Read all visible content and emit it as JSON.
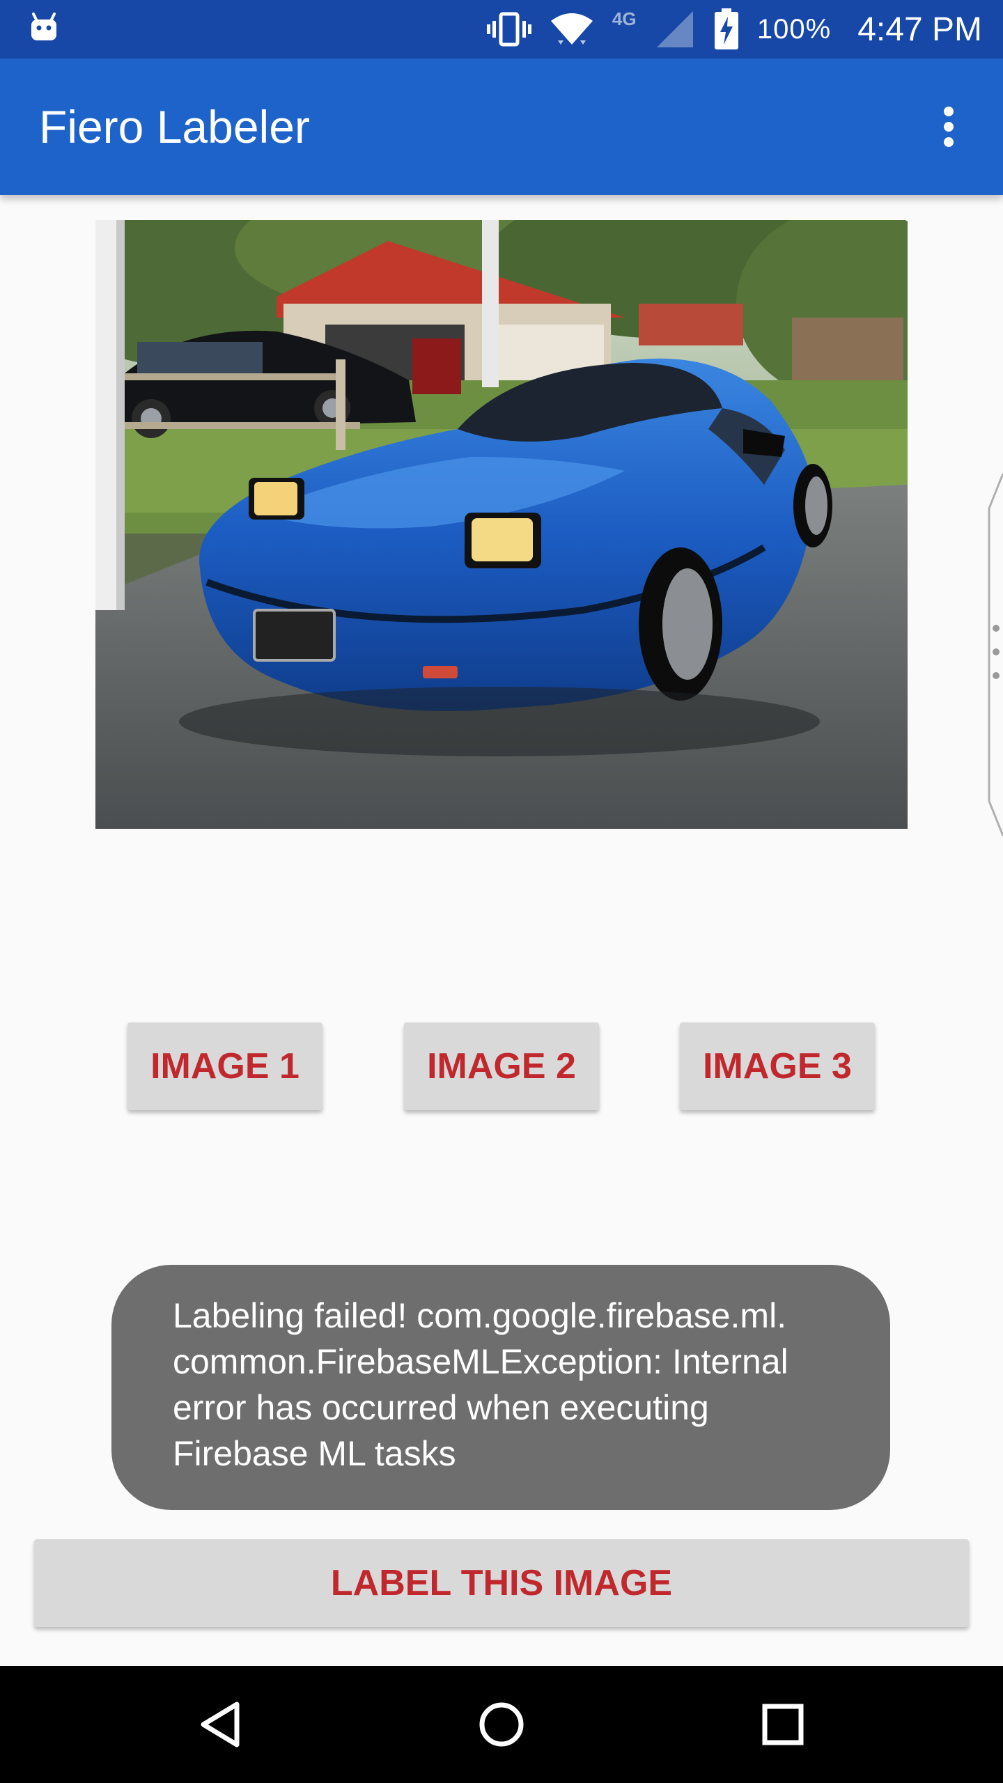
{
  "status_bar": {
    "battery_percent": "100%",
    "time": "4:47 PM",
    "network": "4G",
    "icons": [
      "android-icon",
      "vibrate-icon",
      "wifi-icon",
      "cell-signal-icon",
      "battery-charging-icon"
    ]
  },
  "app_bar": {
    "title": "Fiero Labeler",
    "menu_icon": "more-vert-icon"
  },
  "photo": {
    "subject": "blue-sports-car-photo"
  },
  "buttons": {
    "image1": "IMAGE 1",
    "image2": "IMAGE 2",
    "image3": "IMAGE 3",
    "label": "LABEL THIS IMAGE"
  },
  "toast": {
    "message": "Labeling failed! com.google.firebase.ml.\ncommon.FirebaseMLException: Internal\nerror has occurred when executing\nFirebase ML tasks"
  },
  "nav_bar": {
    "icons": [
      "back-icon",
      "home-icon",
      "recents-icon"
    ]
  },
  "colors": {
    "status_bar": "#1748a8",
    "app_bar": "#1e63c9",
    "button_bg": "#d9d9d9",
    "button_text": "#c0282d",
    "toast_bg": "#6e6e6e",
    "nav_bar": "#000000"
  }
}
